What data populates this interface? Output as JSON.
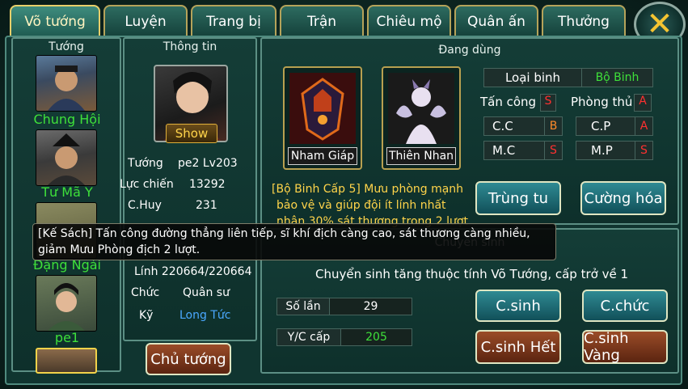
{
  "tabs": [
    "Võ tướng",
    "Luyện",
    "Trang bị",
    "Trận",
    "Chiêu mộ",
    "Quân ấn",
    "Thưởng"
  ],
  "close_symbol": "✕",
  "hero_panel": {
    "title": "Tướng",
    "heroes": [
      "Chung Hội",
      "Tư Mã Y",
      "Đặng Ngải",
      "pe1"
    ]
  },
  "info_panel": {
    "title": "Thông tin",
    "show_label": "Show",
    "rows": [
      {
        "label": "Tướng",
        "value": "pe2 Lv203",
        "color": "#3ee03a"
      },
      {
        "label": "Lực chiến",
        "value": "13292",
        "color": "#ffd44a"
      },
      {
        "label": "C.Huy",
        "value": "231",
        "color": "#3ee03a"
      }
    ],
    "soldiers": "Lính 220664/220664",
    "position_label": "Chức",
    "position_value": "Quân sư",
    "skill_label": "Kỹ",
    "skill_value": "Long Tức",
    "main_button": "Chủ tướng"
  },
  "equipped_panel": {
    "title": "Đang dùng",
    "items": [
      "Nham Giáp",
      "Thiên Nhan"
    ],
    "troop_type_label": "Loại binh",
    "troop_type_value": "Bộ Binh",
    "stats": [
      {
        "label": "Tấn công",
        "grade": "S"
      },
      {
        "label": "Phòng thủ",
        "grade": "A"
      },
      {
        "label": "C.C",
        "grade": "B"
      },
      {
        "label": "C.P",
        "grade": "A"
      },
      {
        "label": "M.C",
        "grade": "S"
      },
      {
        "label": "M.P",
        "grade": "S"
      }
    ],
    "strategy_text_1": "[Bộ Binh Cấp 5] Mưu phòng mạnh",
    "strategy_text_2": "bảo vệ và giúp đội ít lính nhất",
    "strategy_text_3": "nhận 30% sát thương trong 2 lượt",
    "btn_trung_tu": "Trùng tu",
    "btn_cuong_hoa": "Cường hóa"
  },
  "rebirth_panel": {
    "title": "Chuyển sinh",
    "description": "Chuyển sinh tăng thuộc tính Võ Tướng, cấp trở về 1",
    "count_label": "Số lần",
    "count_value": "29",
    "level_label": "Y/C cấp",
    "level_value": "205",
    "btn_csinh": "C.sinh",
    "btn_cchuc": "C.chức",
    "btn_csinh_het": "C.sinh Hết",
    "btn_csinh_vang": "C.sinh Vàng"
  },
  "tooltip": {
    "line1": "[Kế Sách] Tấn công đường thẳng liên tiếp, sĩ khí địch càng cao, sát thương càng nhiều,",
    "line2": "giảm Mưu Phòng địch 2 lượt."
  },
  "colors": {
    "grade_S": "#ff3030",
    "grade_A": "#ff3030",
    "grade_B": "#ff8a2a",
    "troop_value": "#3ee03a",
    "hero_name": "#3ee03a",
    "skill": "#4aa8ff"
  }
}
